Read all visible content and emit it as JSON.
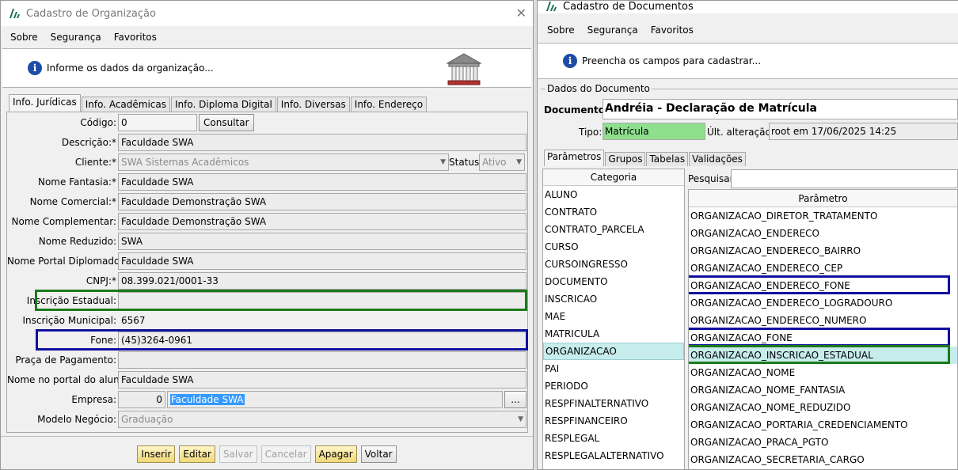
{
  "left_window": {
    "title": "Cadastro de Organização",
    "menu": [
      "Sobre",
      "Segurança",
      "Favoritos"
    ],
    "info_text": "Informe os dados da organização...",
    "tabs": [
      "Info. Jurídicas",
      "Info. Acadêmicas",
      "Info. Diploma Digital",
      "Info. Diversas",
      "Info. Endereço"
    ],
    "fields": {
      "codigo": {
        "label": "Código:",
        "value": "0"
      },
      "consultar": "Consultar",
      "descricao": {
        "label": "Descrição:*",
        "value": "Faculdade SWA"
      },
      "cliente": {
        "label": "Cliente:*",
        "value": "SWA Sistemas Acadêmicos"
      },
      "status": {
        "label": "Status:",
        "value": "Ativo"
      },
      "nome_fantasia": {
        "label": "Nome Fantasia:*",
        "value": "Faculdade SWA"
      },
      "nome_comercial": {
        "label": "Nome Comercial:*",
        "value": "Faculdade Demonstração SWA"
      },
      "nome_complementar": {
        "label": "Nome Complementar:",
        "value": "Faculdade Demonstração SWA"
      },
      "nome_reduzido": {
        "label": "Nome Reduzido:",
        "value": "SWA"
      },
      "nome_portal_diplomados": {
        "label": "Nome Portal Diplomados:",
        "value": "Faculdade SWA"
      },
      "cnpj": {
        "label": "CNPJ:*",
        "value": "08.399.021/0001-33"
      },
      "inscricao_estadual": {
        "label": "Inscrição Estadual:",
        "value": ""
      },
      "inscricao_municipal": {
        "label": "Inscrição Municipal:",
        "value": "6567"
      },
      "fone": {
        "label": "Fone:",
        "value": "(45)3264-0961"
      },
      "praca_pagamento": {
        "label": "Praça de Pagamento:",
        "value": ""
      },
      "nome_portal_aluno": {
        "label": "Nome no portal do aluno:",
        "value": "Faculdade SWA"
      },
      "empresa": {
        "label": "Empresa:",
        "code": "0",
        "value": "Faculdade SWA",
        "lookup": "..."
      },
      "modelo_negocio": {
        "label": "Modelo Negócio:",
        "value": "Graduação"
      }
    },
    "buttons": {
      "inserir": "Inserir",
      "editar": "Editar",
      "salvar": "Salvar",
      "cancelar": "Cancelar",
      "apagar": "Apagar",
      "voltar": "Voltar"
    }
  },
  "right_window": {
    "title": "Cadastro de Documentos",
    "menu": [
      "Sobre",
      "Segurança",
      "Favoritos"
    ],
    "info_text": "Preencha os campos para cadastrar...",
    "group_title": "Dados do Documento",
    "documento_label": "Documento:",
    "documento_value": "Andréia - Declaração de Matrícula",
    "tipo_label": "Tipo:",
    "tipo_value": "Matrícula",
    "ult_label": "Últ. alteração:",
    "ult_value": "root em 17/06/2025 14:25",
    "tabs": [
      "Parâmetros",
      "Grupos",
      "Tabelas",
      "Validações"
    ],
    "categoria_header": "Categoria",
    "categorias": [
      "ALUNO",
      "CONTRATO",
      "CONTRATO_PARCELA",
      "CURSO",
      "CURSOINGRESSO",
      "DOCUMENTO",
      "INSCRICAO",
      "MAE",
      "MATRICULA",
      "ORGANIZACAO",
      "PAI",
      "PERIODO",
      "RESPFINALTERNATIVO",
      "RESPFINANCEIRO",
      "RESPLEGAL",
      "RESPLEGALALTERNATIVO"
    ],
    "categoria_selected": 9,
    "pesquisar_label": "Pesquisar:",
    "pesquisar_value": "",
    "parametro_header": "Parâmetro",
    "parametros": [
      "ORGANIZACAO_DIRETOR_TRATAMENTO",
      "ORGANIZACAO_ENDERECO",
      "ORGANIZACAO_ENDERECO_BAIRRO",
      "ORGANIZACAO_ENDERECO_CEP",
      "ORGANIZACAO_ENDERECO_FONE",
      "ORGANIZACAO_ENDERECO_LOGRADOURO",
      "ORGANIZACAO_ENDERECO_NUMERO",
      "ORGANIZACAO_FONE",
      "ORGANIZACAO_INSCRICAO_ESTADUAL",
      "ORGANIZACAO_NOME",
      "ORGANIZACAO_NOME_FANTASIA",
      "ORGANIZACAO_NOME_REDUZIDO",
      "ORGANIZACAO_PORTARIA_CREDENCIAMENTO",
      "ORGANIZACAO_PRACA_PGTO",
      "ORGANIZACAO_SECRETARIA_CARGO"
    ],
    "parametro_selected": 8
  },
  "colors": {
    "highlight_green": "#1a7a1a",
    "highlight_blue": "#1010a0",
    "selection": "#c7ecec",
    "tipo_green": "#8ee08e"
  }
}
